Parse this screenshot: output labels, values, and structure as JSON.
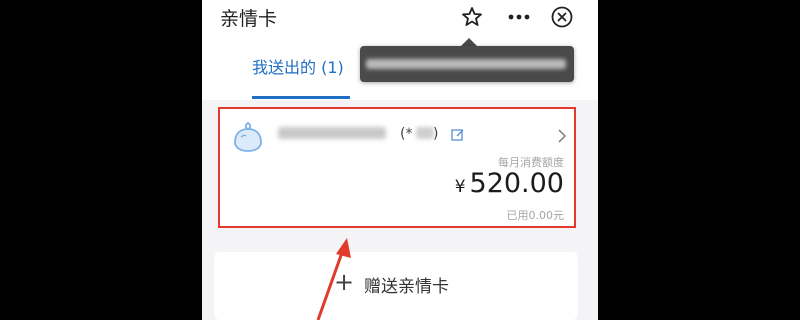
{
  "header": {
    "title": "亲情卡",
    "star_icon": "star-icon",
    "more_icon": "more-icon",
    "close_icon": "close-circle-icon"
  },
  "tabs": [
    {
      "label": "我送出的 (1)",
      "active": true
    }
  ],
  "card": {
    "masked_prefix": "(*",
    "masked_suffix": ")",
    "monthly_limit_label": "每月消费额度",
    "currency": "¥",
    "amount": "520.00",
    "used_label": "已用0.00元",
    "avatar_icon": "bun-avatar-icon",
    "edit_icon": "edit-icon",
    "chevron_icon": "chevron-right-icon",
    "highlight_color": "#e23a2c"
  },
  "gift_button": {
    "plus": "+",
    "label": "赠送亲情卡"
  },
  "colors": {
    "accent": "#1f6fc5",
    "annotation": "#e23a2c"
  }
}
